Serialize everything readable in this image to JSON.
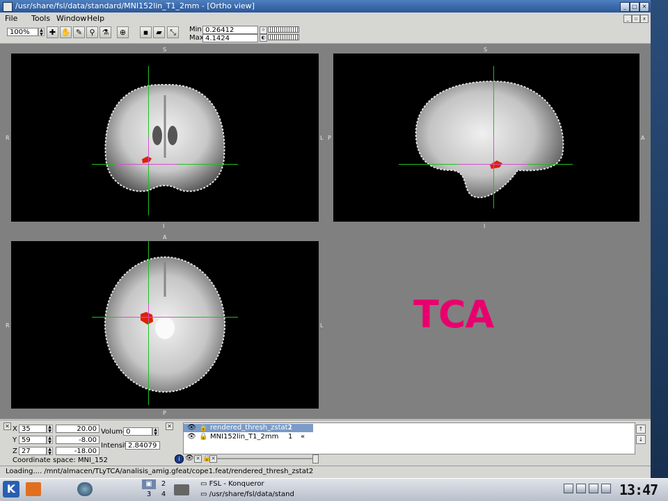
{
  "window": {
    "title": "/usr/share/fsl/data/standard/MNI152lin_T1_2mm - [Ortho view]"
  },
  "menus": [
    "File",
    "Tools",
    "Window",
    "Help"
  ],
  "toolbar": {
    "zoom": "100%",
    "min_label": "Min",
    "min_value": "0.26412",
    "max_label": "Max",
    "max_value": "4.1424"
  },
  "views": {
    "coronal": {
      "top": "S",
      "bottom": "I",
      "left": "R",
      "right": "L"
    },
    "sagittal": {
      "top": "S",
      "bottom": "I",
      "left": "P",
      "right": "A"
    },
    "axial": {
      "top": "A",
      "bottom": "P",
      "left": "R",
      "right": "L"
    }
  },
  "annotation": "TCA",
  "coords": {
    "x_label": "X",
    "x_voxel": "35",
    "x_mm": "20.00",
    "y_label": "Y",
    "y_voxel": "59",
    "y_mm": "-8.00",
    "z_label": "Z",
    "z_voxel": "27",
    "z_mm": "-18.00",
    "space": "Coordinate space: MNI_152",
    "volume_label": "Volume",
    "volume_value": "0",
    "intensity_label": "Intensity",
    "intensity_value": "2.84079"
  },
  "layers": [
    {
      "name": "rendered_thresh_zstat2",
      "value": "1",
      "selected": true
    },
    {
      "name": "MNI152lin_T1_2mm",
      "value": "1",
      "extra": "«",
      "selected": false
    }
  ],
  "status": "Loading.... /mnt/almacen/TLyTCA/analisis_amig.gfeat/cope1.feat/rendered_thresh_zstat2",
  "taskbar": {
    "desktops": [
      "2",
      "3",
      "4"
    ],
    "tasks": [
      "FSL - Konqueror",
      "/usr/share/fsl/data/stand"
    ],
    "clock": "13:47"
  },
  "colors": {
    "overlay": "#e02000",
    "crosshair": "#1fbf1f",
    "cursor": "#d050d0",
    "annotation": "#e8006e"
  }
}
